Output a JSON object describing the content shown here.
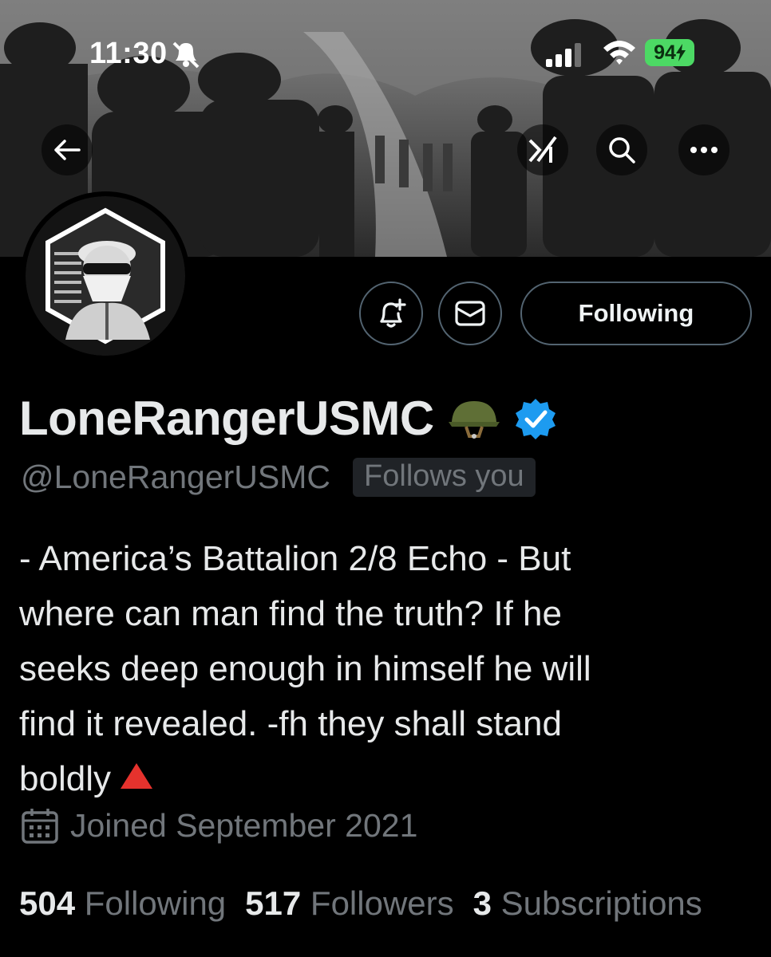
{
  "status_bar": {
    "time": "11:30",
    "battery": "94"
  },
  "banner": {
    "description_icons": [
      "back-arrow-icon",
      "grok-icon",
      "search-icon",
      "more-icon"
    ]
  },
  "actions": {
    "following_label": "Following"
  },
  "profile": {
    "display_name": "LoneRangerUSMC",
    "handle": "@LoneRangerUSMC",
    "follows_you": "Follows you",
    "bio_lines": [
      "- America’s Battalion 2/8 Echo - But",
      "where can man find the truth? If he",
      "seeks deep enough in himself he will",
      "find it revealed. -fh they shall stand",
      "boldly"
    ],
    "joined": "Joined September 2021",
    "following_count": "504",
    "following_label": "Following",
    "followers_count": "517",
    "followers_label": "Followers",
    "subscriptions_count": "3",
    "subscriptions_label": "Subscriptions"
  },
  "colors": {
    "background": "#000000",
    "text_primary": "#e7e9ea",
    "text_secondary": "#71767b",
    "verified_blue": "#1d9bf0",
    "battery_green": "#4cd964",
    "triangle_red": "#e5322d"
  }
}
